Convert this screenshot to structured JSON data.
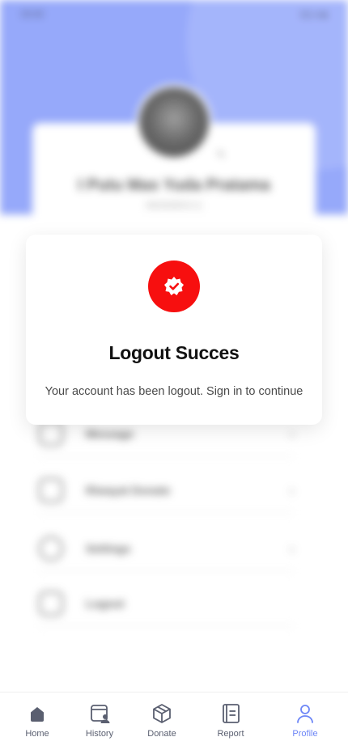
{
  "status_bar": {
    "time": "09:48",
    "indicators": "5G ▾ ■"
  },
  "background": {
    "profile_name": "I Putu Mas Yuda Pratama",
    "profile_sub": "0822628019 11",
    "menu": [
      {
        "label": "Message",
        "icon": "message-icon"
      },
      {
        "label": "Riwayat Donate",
        "icon": "history-file-icon"
      },
      {
        "label": "Settings",
        "icon": "settings-icon"
      },
      {
        "label": "Logout",
        "icon": "logout-icon"
      }
    ]
  },
  "modal": {
    "icon": "badge-check-icon",
    "title": "Logout Succes",
    "message": "Your account has been logout. Sign in to continue"
  },
  "nav": {
    "items": [
      {
        "label": "Home",
        "icon": "home-icon"
      },
      {
        "label": "History",
        "icon": "history-icon"
      },
      {
        "label": "Donate",
        "icon": "box-icon"
      },
      {
        "label": "Report",
        "icon": "report-icon"
      },
      {
        "label": "Profile",
        "icon": "profile-icon"
      }
    ],
    "active": "Profile"
  },
  "colors": {
    "accent": "#6d86f7",
    "hero": "#7f96f9",
    "alert": "#f70f0f"
  }
}
